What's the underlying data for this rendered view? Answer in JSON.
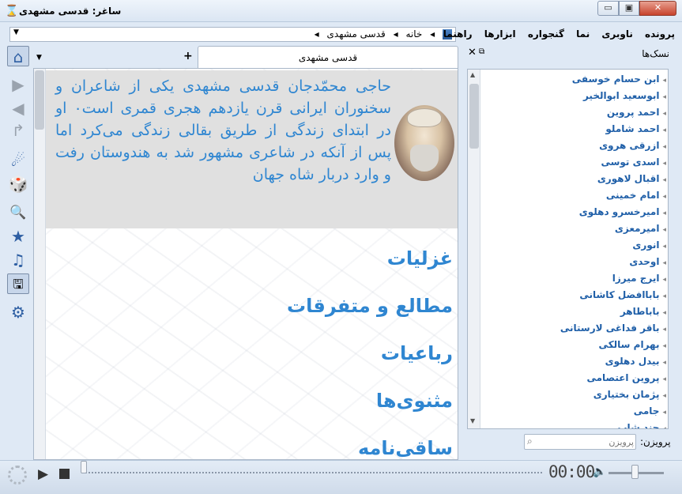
{
  "window": {
    "title": "ساغر: قدسی مشهدی",
    "app_icon": "hourglass-icon",
    "min_glyph": "▭",
    "max_glyph": "▣",
    "close_glyph": "✕"
  },
  "breadcrumb": {
    "items": [
      "خانه",
      "قدسی مشهدی"
    ],
    "separator": "◂",
    "dropdown_glyph": "▼"
  },
  "menu": [
    "پرونده",
    "ناوبری",
    "نما",
    "گنجواره",
    "ابزارها",
    "راهنما"
  ],
  "toolbar": {
    "glyphs": [
      "⌂",
      "▶",
      "◀",
      "↱",
      "☄",
      "🎲",
      "🔍",
      "★",
      "♫",
      "🖫",
      "⚙"
    ]
  },
  "tabs": {
    "add_glyph": "+",
    "dropdown_glyph": "▼",
    "active_label": "قدسی مشهدی"
  },
  "bio": {
    "text": "حاجی محمّدجان قدسی مشهدی یکی از شاعران و سخنوران ایرانی قرن یازدهم هجری قمری است٠ او در ابتدای زندگی از طریق بقالی زندگی می‌کرد اما پس از آنکه در شاعری مشهور شد به هندوستان رفت و وارد دربار شاه جهان"
  },
  "sections": [
    "غزلیات",
    "مطالع و متفرقات",
    "رباعیات",
    "مثنوی‌ها",
    "ساقی‌نامه"
  ],
  "bookmarks_panel": {
    "title": "نسک‌ها",
    "close_glyph": "✕",
    "float_glyph": "⧉",
    "poets": [
      "ابن حسام خوسفی",
      "ابوسعید ابوالخیر",
      "احمد پروین",
      "احمد شاملو",
      "ازرقی هروی",
      "اسدی توسی",
      "اقبال لاهوری",
      "امام خمینی",
      "امیرخسرو دهلوی",
      "امیرمعزی",
      "انوری",
      "اوحدی",
      "ایرج میرزا",
      "باباافضل کاشانی",
      "باباطاهر",
      "باقر فداغی لارستانی",
      "بهرام سالکی",
      "بیدل دهلوی",
      "پروین اعتصامی",
      "پژمان بختیاری",
      "جامی",
      "جند شاپ"
    ]
  },
  "search": {
    "label": "پرویزن:",
    "placeholder": "پرویزن"
  },
  "player": {
    "time": "00:00",
    "play_glyph": "▶",
    "volume_glyph": "🔈"
  }
}
